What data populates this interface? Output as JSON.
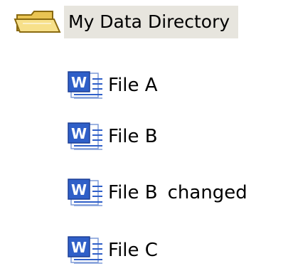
{
  "folder": {
    "label": "My Data Directory",
    "icon": "folder-open-icon",
    "highlight_color": "#e7e5de"
  },
  "files": [
    {
      "label": "File A",
      "extra": "",
      "icon": "word-document-icon"
    },
    {
      "label": "File B",
      "extra": "",
      "icon": "word-document-icon"
    },
    {
      "label": "File B",
      "extra": "changed",
      "icon": "word-document-icon"
    },
    {
      "label": "File C",
      "extra": "",
      "icon": "word-document-icon"
    }
  ],
  "colors": {
    "folder_fill": "#f4dc7a",
    "folder_stroke": "#8a6a10",
    "doc_blue": "#2f5fc8"
  }
}
